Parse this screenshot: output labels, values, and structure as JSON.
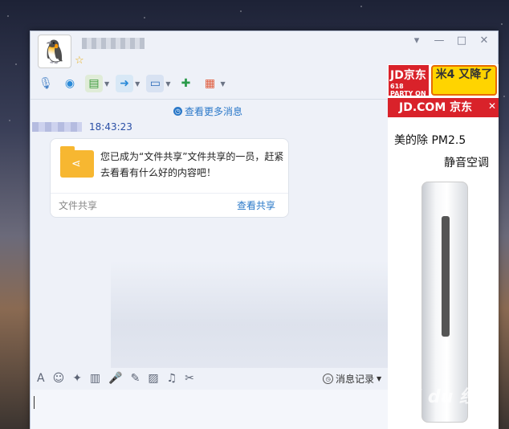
{
  "window": {
    "avatar_icon": "🐧",
    "star_icon": "☆",
    "controls": {
      "menu": "▾",
      "minimize": "—",
      "maximize": "□",
      "close": "✕"
    }
  },
  "toolbar": {
    "items": [
      {
        "icon": "🎙",
        "name": "voice-call",
        "dropdown": false
      },
      {
        "icon": "◉",
        "name": "video-call",
        "dropdown": false
      },
      {
        "icon": "▤",
        "name": "remote-desktop",
        "dropdown": true
      },
      {
        "icon": "➜",
        "name": "send-file",
        "dropdown": true
      },
      {
        "icon": "▭",
        "name": "screen-share",
        "dropdown": true
      },
      {
        "icon": "✚",
        "name": "create-discussion",
        "dropdown": false
      },
      {
        "icon": "▦",
        "name": "apps",
        "dropdown": true
      }
    ]
  },
  "chat": {
    "more_messages": "查看更多消息",
    "time": "18:43:23",
    "card": {
      "text": "您已成为“文件共享”文件共享的一员，赶紧去看看有什么好的内容吧！",
      "footer_left": "文件共享",
      "footer_right": "查看共享"
    }
  },
  "input_toolbar": {
    "icons": [
      "A",
      "☺",
      "✦",
      "▥",
      "🎤",
      "✎",
      "▨",
      "♫",
      "✂"
    ],
    "history_label": "消息记录"
  },
  "ad": {
    "jd_logo": "JD京东",
    "jd_sub": "618 PARTY ON",
    "mi_text": "米4 又降了",
    "jd_bar": "JD.COM 京东",
    "close": "✕",
    "line1": "美的除 PM2.5",
    "line2": "静音空调"
  },
  "watermark": "Bai du 经验"
}
